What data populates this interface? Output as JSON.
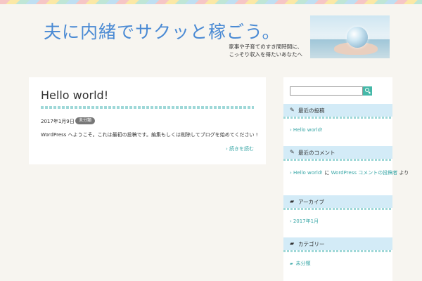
{
  "site": {
    "title": "夫に内緒でサクッと稼ごう。",
    "tagline": "家事や子育てのすき間時間に、こっそり収入を得たいあなたへ"
  },
  "post": {
    "title": "Hello world!",
    "date": "2017年1月9日",
    "category": "未分類",
    "excerpt": "WordPress へようこそ。これは最初の投稿です。編集もしくは削除してブログを始めてください !",
    "read_more": "続きを読む"
  },
  "sidebar": {
    "recent_posts": {
      "icon": "pencil-icon",
      "title": "最近の投稿",
      "items": [
        "Hello world!"
      ]
    },
    "recent_comments": {
      "icon": "pencil-icon",
      "title": "最近のコメント",
      "link1": "Hello world!",
      "sep1": "に",
      "link2": "WordPress コメントの投稿者",
      "sep2": "より"
    },
    "archives": {
      "icon": "folder-icon",
      "title": "アーカイブ",
      "items": [
        "2017年1月"
      ]
    },
    "categories": {
      "icon": "folder-icon",
      "title": "カテゴリー",
      "items": [
        "未分類"
      ]
    }
  },
  "colors": {
    "accent": "#3aa7a7",
    "title_blue": "#4a8ad4",
    "widget_header_bg": "#d3ebf7"
  }
}
